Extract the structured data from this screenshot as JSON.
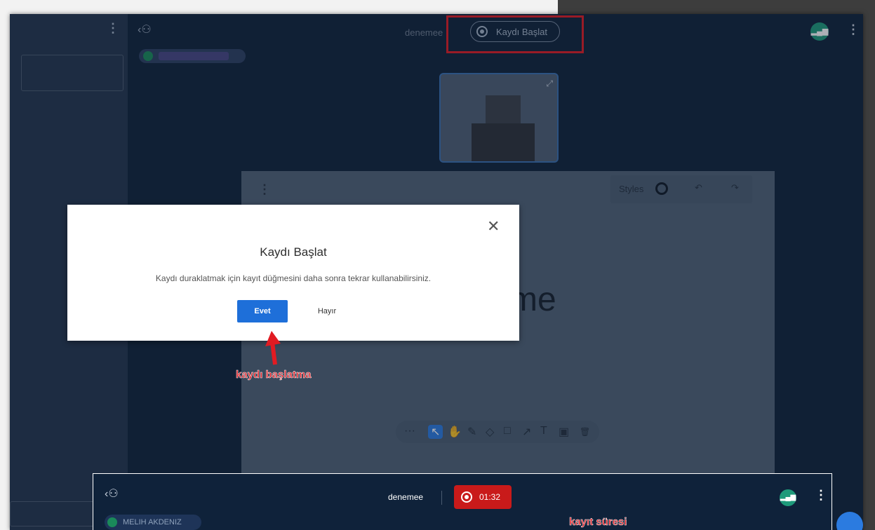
{
  "top_bar": {
    "meeting_name": "denemee",
    "record_label": "Kaydı Başlat"
  },
  "whiteboard": {
    "styles_label": "Styles",
    "big_text": "me",
    "tools": [
      "···",
      "↖",
      "✋",
      "✎",
      "◇",
      "□",
      "↗",
      "T",
      "▣",
      "🗑"
    ]
  },
  "dialog": {
    "title": "Kaydı Başlat",
    "message": "Kaydı duraklatmak için kayıt düğmesini daha sonra tekrar kullanabilirsiniz.",
    "yes": "Evet",
    "no": "Hayır"
  },
  "annotations": {
    "start_recording": "kaydı başlatma",
    "record_duration": "kayıt süresi"
  },
  "bottom_bar": {
    "meeting_name": "denemee",
    "timer": "01:32",
    "user_name": "MELIH AKDENIZ"
  },
  "colors": {
    "highlight": "#e11b22",
    "record_active": "#c91a1a",
    "primary": "#1e6fd9",
    "app_bg": "#0f223a"
  }
}
